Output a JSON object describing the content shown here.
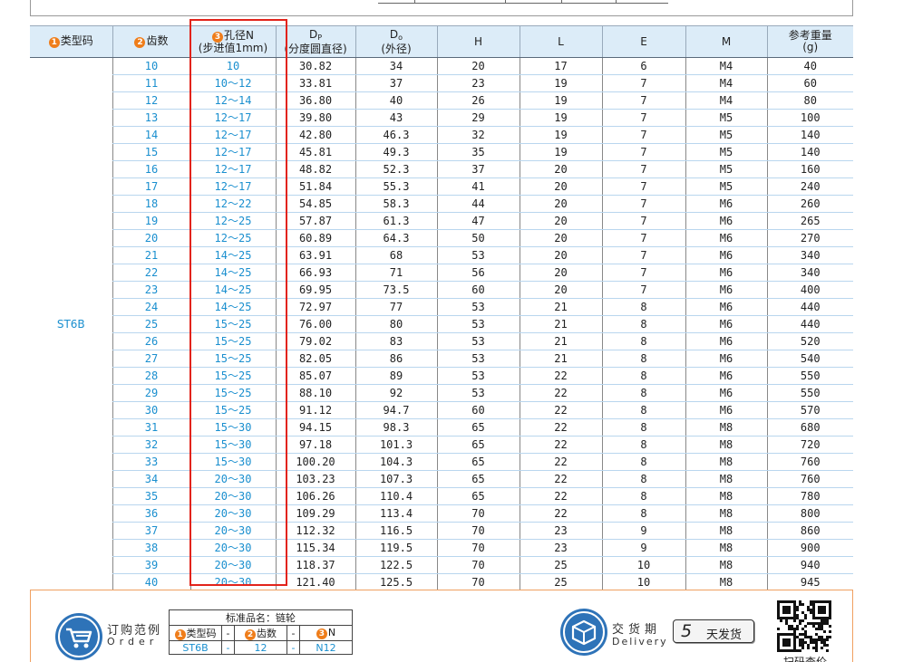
{
  "table": {
    "headers": {
      "type": "类型码",
      "teeth": "齿数",
      "bore_line1": "孔径N",
      "bore_line2": "(步进值1mm)",
      "dp_sub": "P",
      "dp_note": "(分度圆直径)",
      "do_sub": "o",
      "do_note": "(外径)",
      "h": "H",
      "l": "L",
      "e": "E",
      "m": "M",
      "weight_line1": "参考重量",
      "weight_line2": "(g)"
    },
    "badges": [
      "1",
      "2",
      "3"
    ],
    "type_code": "ST6B",
    "rows": [
      [
        "10",
        "10",
        "30.82",
        "34",
        "20",
        "17",
        "6",
        "M4",
        "40"
      ],
      [
        "11",
        "10～12",
        "33.81",
        "37",
        "23",
        "19",
        "7",
        "M4",
        "60"
      ],
      [
        "12",
        "12～14",
        "36.80",
        "40",
        "26",
        "19",
        "7",
        "M4",
        "80"
      ],
      [
        "13",
        "12～17",
        "39.80",
        "43",
        "29",
        "19",
        "7",
        "M5",
        "100"
      ],
      [
        "14",
        "12～17",
        "42.80",
        "46.3",
        "32",
        "19",
        "7",
        "M5",
        "140"
      ],
      [
        "15",
        "12～17",
        "45.81",
        "49.3",
        "35",
        "19",
        "7",
        "M5",
        "140"
      ],
      [
        "16",
        "12～17",
        "48.82",
        "52.3",
        "37",
        "20",
        "7",
        "M5",
        "160"
      ],
      [
        "17",
        "12～17",
        "51.84",
        "55.3",
        "41",
        "20",
        "7",
        "M5",
        "240"
      ],
      [
        "18",
        "12～22",
        "54.85",
        "58.3",
        "44",
        "20",
        "7",
        "M6",
        "260"
      ],
      [
        "19",
        "12～25",
        "57.87",
        "61.3",
        "47",
        "20",
        "7",
        "M6",
        "265"
      ],
      [
        "20",
        "12～25",
        "60.89",
        "64.3",
        "50",
        "20",
        "7",
        "M6",
        "270"
      ],
      [
        "21",
        "14～25",
        "63.91",
        "68",
        "53",
        "20",
        "7",
        "M6",
        "340"
      ],
      [
        "22",
        "14～25",
        "66.93",
        "71",
        "56",
        "20",
        "7",
        "M6",
        "340"
      ],
      [
        "23",
        "14～25",
        "69.95",
        "73.5",
        "60",
        "20",
        "7",
        "M6",
        "400"
      ],
      [
        "24",
        "14～25",
        "72.97",
        "77",
        "53",
        "21",
        "8",
        "M6",
        "440"
      ],
      [
        "25",
        "15～25",
        "76.00",
        "80",
        "53",
        "21",
        "8",
        "M6",
        "440"
      ],
      [
        "26",
        "15～25",
        "79.02",
        "83",
        "53",
        "21",
        "8",
        "M6",
        "520"
      ],
      [
        "27",
        "15～25",
        "82.05",
        "86",
        "53",
        "21",
        "8",
        "M6",
        "540"
      ],
      [
        "28",
        "15～25",
        "85.07",
        "89",
        "53",
        "22",
        "8",
        "M6",
        "550"
      ],
      [
        "29",
        "15～25",
        "88.10",
        "92",
        "53",
        "22",
        "8",
        "M6",
        "550"
      ],
      [
        "30",
        "15～25",
        "91.12",
        "94.7",
        "60",
        "22",
        "8",
        "M6",
        "570"
      ],
      [
        "31",
        "15～30",
        "94.15",
        "98.3",
        "65",
        "22",
        "8",
        "M8",
        "680"
      ],
      [
        "32",
        "15～30",
        "97.18",
        "101.3",
        "65",
        "22",
        "8",
        "M8",
        "720"
      ],
      [
        "33",
        "15～30",
        "100.20",
        "104.3",
        "65",
        "22",
        "8",
        "M8",
        "760"
      ],
      [
        "34",
        "20～30",
        "103.23",
        "107.3",
        "65",
        "22",
        "8",
        "M8",
        "760"
      ],
      [
        "35",
        "20～30",
        "106.26",
        "110.4",
        "65",
        "22",
        "8",
        "M8",
        "780"
      ],
      [
        "36",
        "20～30",
        "109.29",
        "113.4",
        "70",
        "22",
        "8",
        "M8",
        "800"
      ],
      [
        "37",
        "20～30",
        "112.32",
        "116.5",
        "70",
        "23",
        "9",
        "M8",
        "860"
      ],
      [
        "38",
        "20～30",
        "115.34",
        "119.5",
        "70",
        "23",
        "9",
        "M8",
        "900"
      ],
      [
        "39",
        "20～30",
        "118.37",
        "122.5",
        "70",
        "25",
        "10",
        "M8",
        "940"
      ],
      [
        "40",
        "20～30",
        "121.40",
        "125.5",
        "70",
        "25",
        "10",
        "M8",
        "945"
      ]
    ]
  },
  "order": {
    "title_cn": "订购范例",
    "title_en": "Order",
    "std_name": "标准品名：链轮",
    "col_type": "类型码",
    "col_teeth": "齿数",
    "col_bore": "N",
    "dash": "-",
    "val_type": "ST6B",
    "val_teeth": "12",
    "val_bore": "N12"
  },
  "delivery": {
    "title_cn": "交货期",
    "title_en": "Delivery",
    "days": "5",
    "days_label": "天发货"
  },
  "qr": {
    "label": "扫码查价"
  },
  "colors": {
    "header_bg": "#dcecf8",
    "accent_blue": "#1a8fcf",
    "badge_orange": "#ef7d1a",
    "highlight_red": "#e2231a",
    "icon_blue": "#2e73b8"
  }
}
